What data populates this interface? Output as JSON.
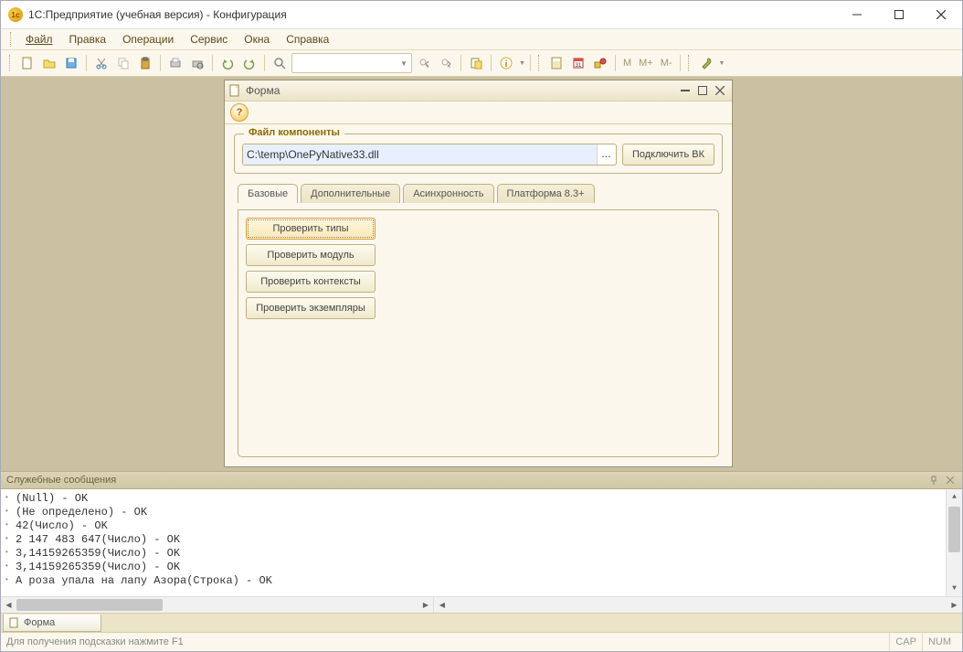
{
  "app": {
    "icon_text": "1c",
    "title": "1С:Предприятие (учебная версия) - Конфигурация"
  },
  "menu": {
    "file": "Файл",
    "edit": "Правка",
    "operations": "Операции",
    "service": "Сервис",
    "windows": "Окна",
    "help": "Справка"
  },
  "toolbar": {
    "m": "M",
    "m_plus": "M+",
    "m_minus": "M-"
  },
  "form": {
    "title": "Форма",
    "group_title": "Файл компоненты",
    "file_path": "C:\\temp\\OnePyNative33.dll",
    "connect_btn": "Подключить ВК",
    "tabs": {
      "basic": "Базовые",
      "additional": "Дополнительные",
      "async": "Асинхронность",
      "platform": "Платформа 8.3+"
    },
    "buttons": {
      "check_types": "Проверить типы",
      "check_module": "Проверить модуль",
      "check_contexts": "Проверить контексты",
      "check_instances": "Проверить экземпляры"
    }
  },
  "messages": {
    "title": "Служебные сообщения",
    "lines": [
      "(Null) - OK",
      "(Не определено) - OK",
      "42(Число) - OK",
      "2 147 483 647(Число) - OK",
      "3,14159265359(Число) - OK",
      "3,14159265359(Число) - OK",
      "А роза упала на лапу Азора(Строка) - OK"
    ]
  },
  "window_tabs": {
    "form": "Форма"
  },
  "status": {
    "hint": "Для получения подсказки нажмите F1",
    "cap": "CAP",
    "num": "NUM"
  }
}
